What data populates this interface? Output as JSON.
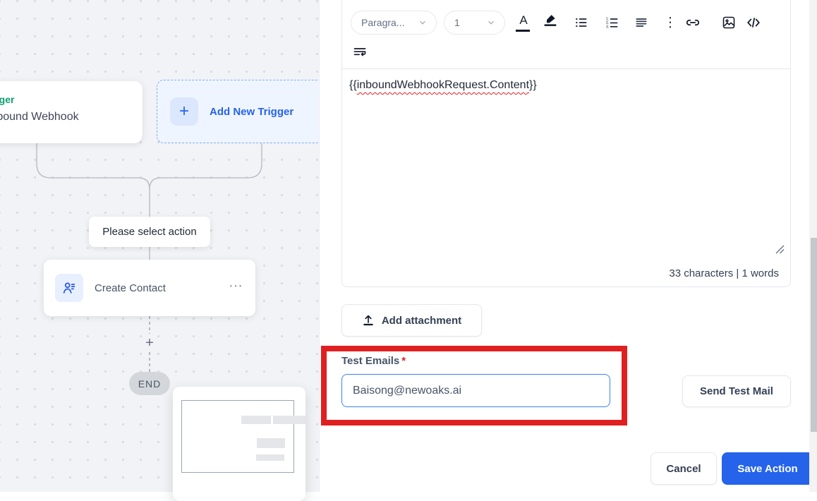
{
  "canvas": {
    "trigger_card": {
      "category": "Trigger",
      "title": "Inbound Webhook"
    },
    "add_new_trigger_label": "Add New Trigger",
    "plus_glyph": "+",
    "select_action_label": "Please select action",
    "create_contact_label": "Create Contact",
    "menu_dots_glyph": "⋯",
    "end_label": "END"
  },
  "editor": {
    "paragraph_dropdown": "Paragra...",
    "font_size_dropdown": "1",
    "content": {
      "open_braces": "{{",
      "variable": "inboundWebhookRequest.Content",
      "close_braces": "}}"
    },
    "status_text": "33 characters | 1 words",
    "kebab_glyph": "⋮"
  },
  "buttons": {
    "add_attachment": "Add attachment",
    "send_test_mail": "Send Test Mail",
    "cancel": "Cancel",
    "save_action": "Save Action"
  },
  "test_email": {
    "label": "Test Emails",
    "required_mark": "*",
    "value": "Baisong@newoaks.ai"
  },
  "icons": [
    "text-color-icon",
    "highlighter-icon",
    "bullet-list-icon",
    "numbered-list-icon",
    "align-left-icon",
    "kebab-menu-icon",
    "link-icon",
    "image-icon",
    "code-icon",
    "text-wrap-icon",
    "upload-icon",
    "contact-icon",
    "plus-icon",
    "resize-handle-icon"
  ],
  "colors": {
    "accent_blue": "#2563eb",
    "annotation_red": "#e02020",
    "trigger_green": "#0e9f6e",
    "input_border_blue": "#3b82f6",
    "squiggle_red": "#e11d1d"
  }
}
